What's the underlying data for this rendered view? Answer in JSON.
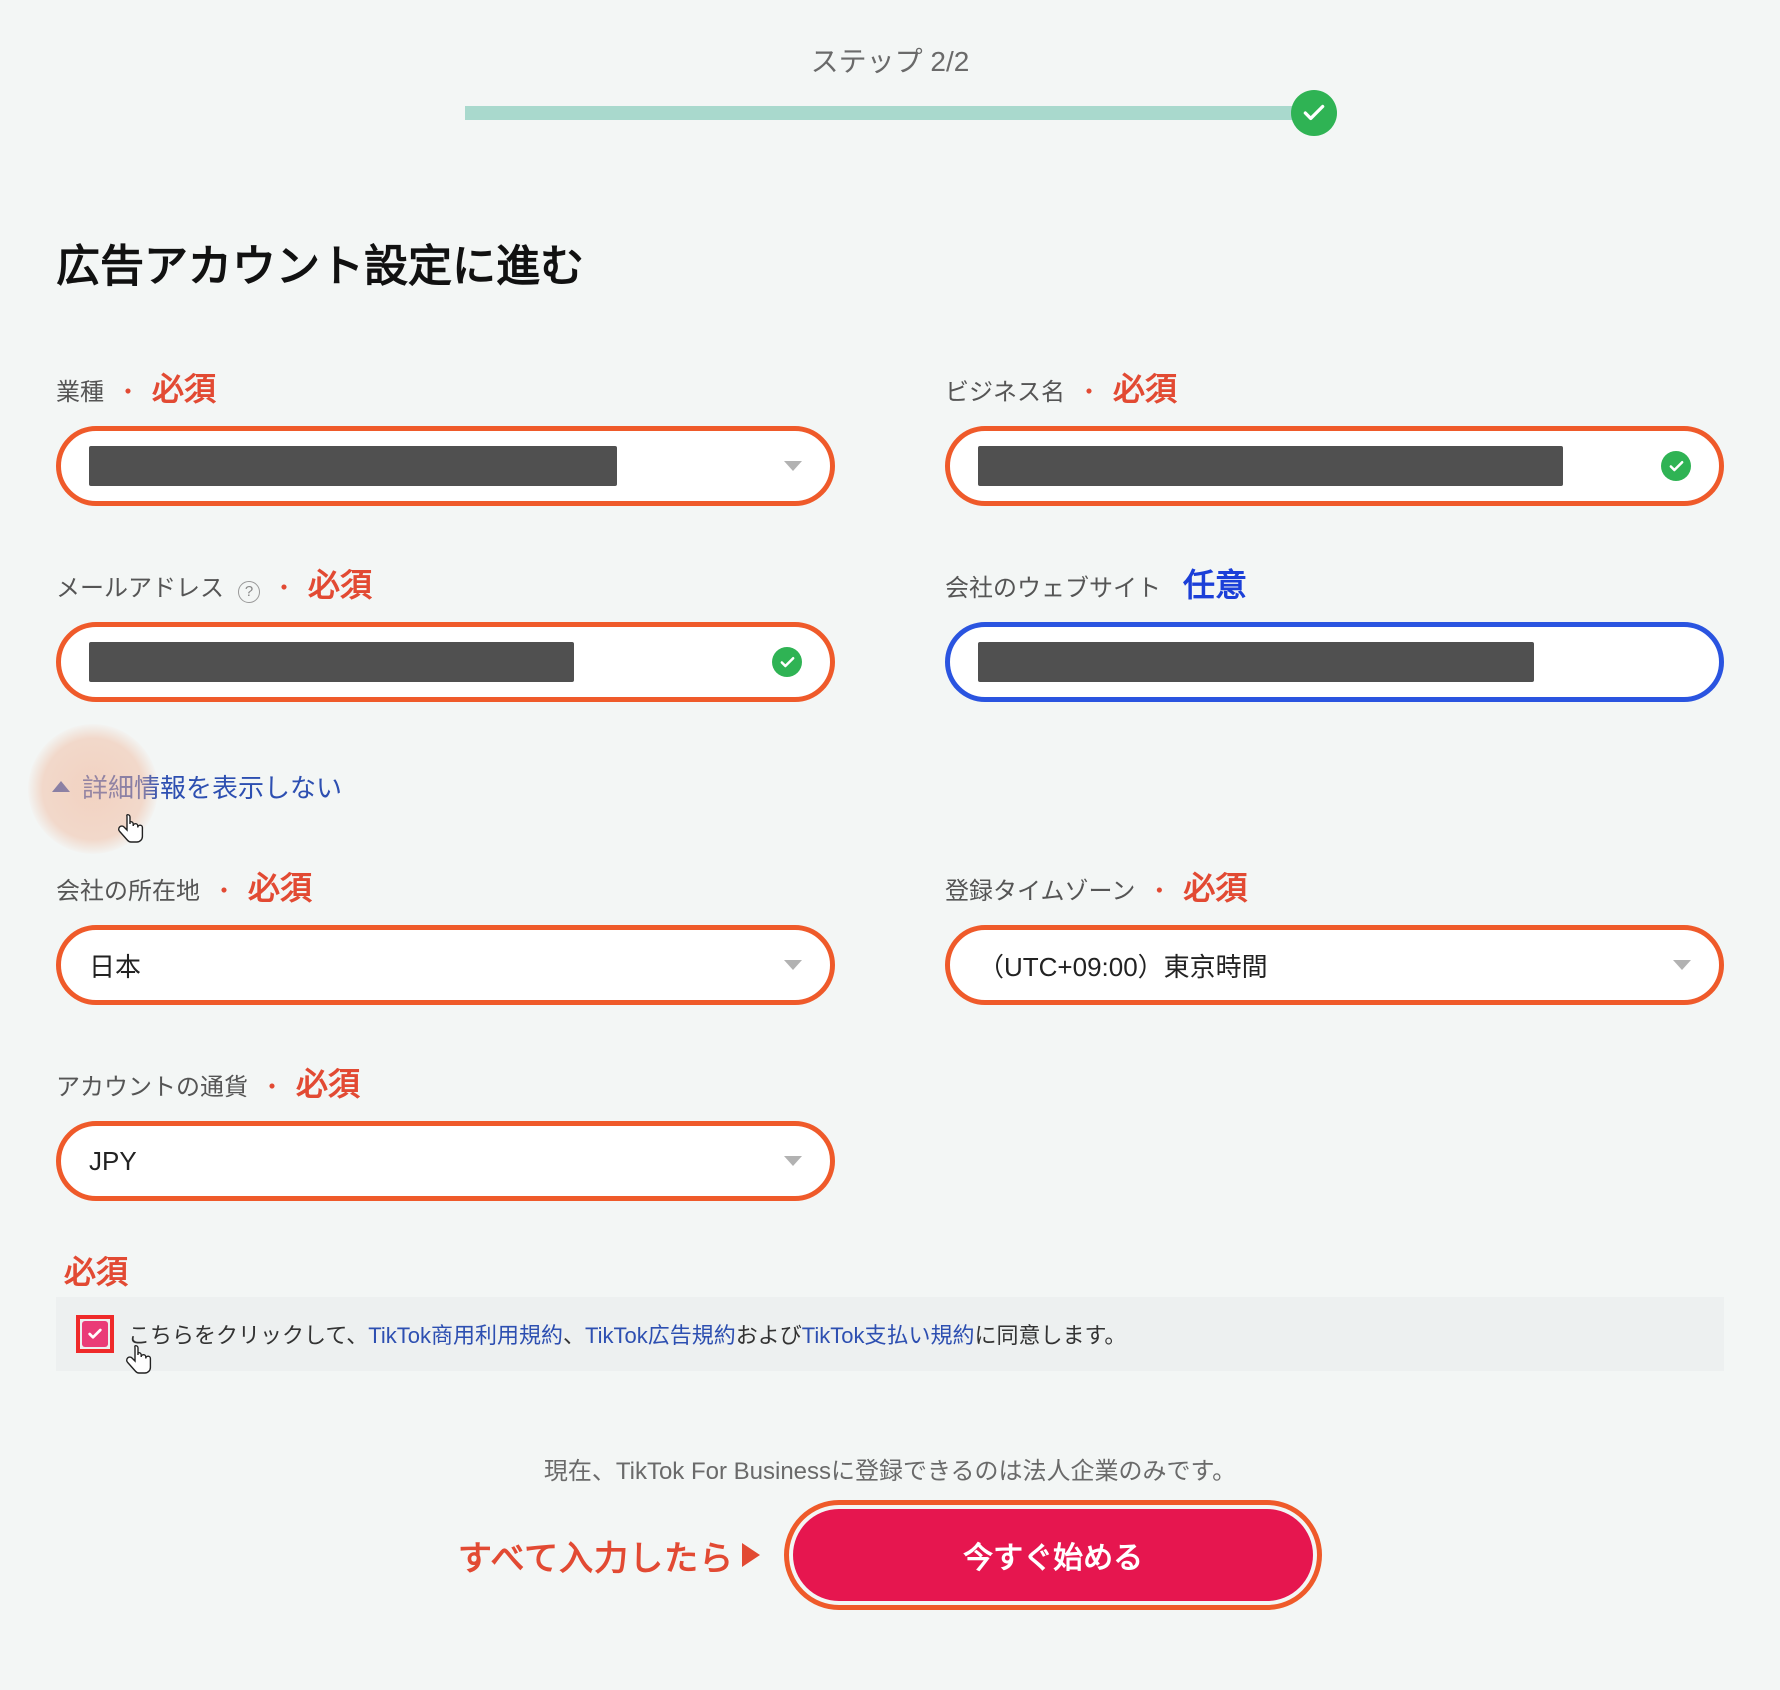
{
  "step_label": "ステップ 2/2",
  "page_title": "広告アカウント設定に進む",
  "badges": {
    "required": "必須",
    "optional": "任意"
  },
  "fields": {
    "industry": {
      "label": "業種"
    },
    "business": {
      "label": "ビジネス名"
    },
    "email": {
      "label": "メールアドレス"
    },
    "website": {
      "label": "会社のウェブサイト"
    },
    "location": {
      "label": "会社の所在地",
      "value": "日本"
    },
    "timezone": {
      "label": "登録タイムゾーン",
      "value": "（UTC+09:00）東京時間"
    },
    "currency": {
      "label": "アカウントの通貨",
      "value": "JPY"
    }
  },
  "collapse_label": "詳細情報を表示しない",
  "agreement": {
    "prefix": "こちらをクリックして、",
    "link1": "TikTok商用利用規約",
    "sep1": "、",
    "link2": "TikTok広告規約",
    "sep2": "および",
    "link3": "TikTok支払い規約",
    "suffix": "に同意します。"
  },
  "bottom_note": "現在、TikTok For Businessに登録できるのは法人企業のみです。",
  "cta_hint": "すべて入力したら",
  "cta_label": "今すぐ始める"
}
